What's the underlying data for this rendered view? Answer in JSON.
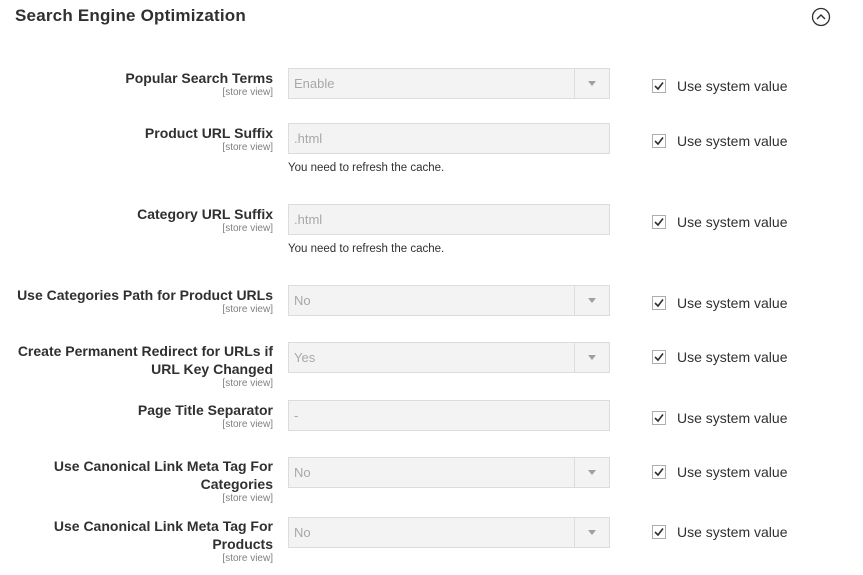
{
  "section": {
    "title": "Search Engine Optimization"
  },
  "common": {
    "scope": "[store view]",
    "use_system_value": "Use system value",
    "cache_note": "You need to refresh the cache."
  },
  "rows": [
    {
      "label": "Popular Search Terms",
      "type": "select",
      "value": "Enable",
      "checked": true
    },
    {
      "label": "Product URL Suffix",
      "type": "input",
      "value": ".html",
      "checked": true
    },
    {
      "label": "Category URL Suffix",
      "type": "input",
      "value": ".html",
      "checked": true
    },
    {
      "label": "Use Categories Path for Product URLs",
      "type": "select",
      "value": "No",
      "checked": true
    },
    {
      "label_line1": "Create Permanent Redirect for URLs if",
      "label_line2": "URL Key Changed",
      "type": "select",
      "value": "Yes",
      "checked": true
    },
    {
      "label": "Page Title Separator",
      "type": "input",
      "value": "-",
      "checked": true
    },
    {
      "label_line1": "Use Canonical Link Meta Tag For",
      "label_line2": "Categories",
      "type": "select",
      "value": "No",
      "checked": true
    },
    {
      "label_line1": "Use Canonical Link Meta Tag For",
      "label_line2": "Products",
      "type": "select",
      "value": "No",
      "checked": true
    }
  ]
}
